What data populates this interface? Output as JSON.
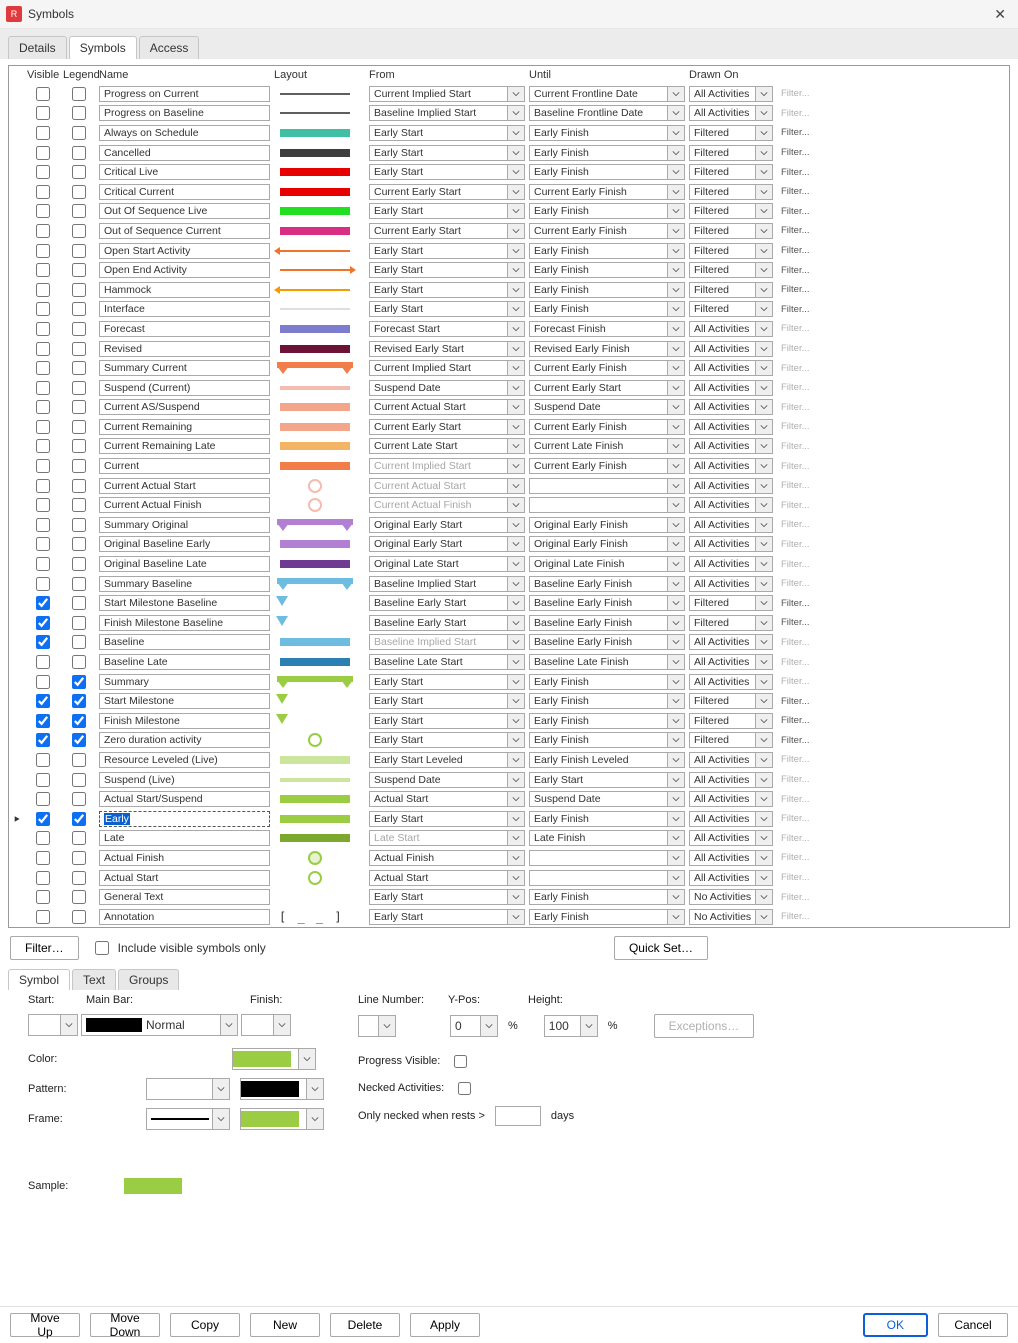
{
  "title": "Symbols",
  "main_tabs": [
    "Details",
    "Symbols",
    "Access"
  ],
  "active_main_tab": 1,
  "columns": [
    "Visible",
    "Legend",
    "Name",
    "Layout",
    "From",
    "Until",
    "Drawn On"
  ],
  "rows": [
    {
      "visible": false,
      "legend": false,
      "name": "Progress on Current",
      "style": {
        "kind": "line",
        "color": "#5f5f5f"
      },
      "from": "Current Implied Start",
      "from_disabled": false,
      "until": "Current Frontline Date",
      "until_disabled": false,
      "drawn": "All Activities",
      "filter_disabled": true
    },
    {
      "visible": false,
      "legend": false,
      "name": "Progress on Baseline",
      "style": {
        "kind": "line",
        "color": "#5f5f5f"
      },
      "from": "Baseline Implied Start",
      "from_disabled": false,
      "until": "Baseline Frontline Date",
      "until_disabled": false,
      "drawn": "All Activities",
      "filter_disabled": true
    },
    {
      "visible": false,
      "legend": false,
      "name": "Always on Schedule",
      "style": {
        "kind": "bar",
        "color": "#3fbfa3"
      },
      "from": "Early Start",
      "from_disabled": false,
      "until": "Early Finish",
      "until_disabled": false,
      "drawn": "Filtered",
      "filter_disabled": false
    },
    {
      "visible": false,
      "legend": false,
      "name": "Cancelled",
      "style": {
        "kind": "bar",
        "color": "#3e3e3e"
      },
      "from": "Early Start",
      "from_disabled": false,
      "until": "Early Finish",
      "until_disabled": false,
      "drawn": "Filtered",
      "filter_disabled": false
    },
    {
      "visible": false,
      "legend": false,
      "name": "Critical Live",
      "style": {
        "kind": "bar",
        "color": "#e80000"
      },
      "from": "Early Start",
      "from_disabled": false,
      "until": "Early Finish",
      "until_disabled": false,
      "drawn": "Filtered",
      "filter_disabled": false
    },
    {
      "visible": false,
      "legend": false,
      "name": "Critical Current",
      "style": {
        "kind": "bar",
        "color": "#e80000"
      },
      "from": "Current Early Start",
      "from_disabled": false,
      "until": "Current Early Finish",
      "until_disabled": false,
      "drawn": "Filtered",
      "filter_disabled": false
    },
    {
      "visible": false,
      "legend": false,
      "name": "Out Of Sequence Live",
      "style": {
        "kind": "bar",
        "color": "#21e021"
      },
      "from": "Early Start",
      "from_disabled": false,
      "until": "Early Finish",
      "until_disabled": false,
      "drawn": "Filtered",
      "filter_disabled": false
    },
    {
      "visible": false,
      "legend": false,
      "name": "Out of Sequence Current",
      "style": {
        "kind": "bar",
        "color": "#d82f84"
      },
      "from": "Current Early Start",
      "from_disabled": false,
      "until": "Current Early Finish",
      "until_disabled": false,
      "drawn": "Filtered",
      "filter_disabled": false
    },
    {
      "visible": false,
      "legend": false,
      "name": "Open Start Activity",
      "style": {
        "kind": "arrow-left",
        "color": "#f1742b"
      },
      "from": "Early Start",
      "from_disabled": false,
      "until": "Early Finish",
      "until_disabled": false,
      "drawn": "Filtered",
      "filter_disabled": false
    },
    {
      "visible": false,
      "legend": false,
      "name": "Open End Activity",
      "style": {
        "kind": "arrow-right",
        "color": "#f1742b"
      },
      "from": "Early Start",
      "from_disabled": false,
      "until": "Early Finish",
      "until_disabled": false,
      "drawn": "Filtered",
      "filter_disabled": false
    },
    {
      "visible": false,
      "legend": false,
      "name": "Hammock",
      "style": {
        "kind": "arrow-left",
        "color": "#f59b00"
      },
      "from": "Early Start",
      "from_disabled": false,
      "until": "Early Finish",
      "until_disabled": false,
      "drawn": "Filtered",
      "filter_disabled": false
    },
    {
      "visible": false,
      "legend": false,
      "name": "Interface",
      "style": {
        "kind": "line",
        "color": "#dedede"
      },
      "from": "Early Start",
      "from_disabled": false,
      "until": "Early Finish",
      "until_disabled": false,
      "drawn": "Filtered",
      "filter_disabled": false
    },
    {
      "visible": false,
      "legend": false,
      "name": "Forecast",
      "style": {
        "kind": "bar",
        "color": "#7d7ccf"
      },
      "from": "Forecast Start",
      "from_disabled": false,
      "until": "Forecast Finish",
      "until_disabled": false,
      "drawn": "All Activities",
      "filter_disabled": true
    },
    {
      "visible": false,
      "legend": false,
      "name": "Revised",
      "style": {
        "kind": "bar",
        "color": "#6c1237"
      },
      "from": "Revised Early Start",
      "from_disabled": false,
      "until": "Revised Early Finish",
      "until_disabled": false,
      "drawn": "All Activities",
      "filter_disabled": true
    },
    {
      "visible": false,
      "legend": false,
      "name": "Summary Current",
      "style": {
        "kind": "summary",
        "color": "#f17d49"
      },
      "from": "Current Implied Start",
      "from_disabled": false,
      "until": "Current Early Finish",
      "until_disabled": false,
      "drawn": "All Activities",
      "filter_disabled": true
    },
    {
      "visible": false,
      "legend": false,
      "name": "Suspend (Current)",
      "style": {
        "kind": "thin",
        "color": "#f4bcb0"
      },
      "from": "Suspend Date",
      "from_disabled": false,
      "until": "Current Early Start",
      "until_disabled": false,
      "drawn": "All Activities",
      "filter_disabled": true
    },
    {
      "visible": false,
      "legend": false,
      "name": "Current AS/Suspend",
      "style": {
        "kind": "bar",
        "color": "#f3a68a"
      },
      "from": "Current Actual Start",
      "from_disabled": false,
      "until": "Suspend Date",
      "until_disabled": false,
      "drawn": "All Activities",
      "filter_disabled": true
    },
    {
      "visible": false,
      "legend": false,
      "name": "Current Remaining",
      "style": {
        "kind": "bar",
        "color": "#f3a68a"
      },
      "from": "Current Early Start",
      "from_disabled": false,
      "until": "Current Early Finish",
      "until_disabled": false,
      "drawn": "All Activities",
      "filter_disabled": true
    },
    {
      "visible": false,
      "legend": false,
      "name": "Current Remaining Late",
      "style": {
        "kind": "bar",
        "color": "#f3b563"
      },
      "from": "Current Late Start",
      "from_disabled": false,
      "until": "Current Late Finish",
      "until_disabled": false,
      "drawn": "All Activities",
      "filter_disabled": true
    },
    {
      "visible": false,
      "legend": false,
      "name": "Current",
      "style": {
        "kind": "bar",
        "color": "#f17d49"
      },
      "from": "Current Implied Start",
      "from_disabled": true,
      "until": "Current Early Finish",
      "until_disabled": false,
      "drawn": "All Activities",
      "filter_disabled": true
    },
    {
      "visible": false,
      "legend": false,
      "name": "Current Actual Start",
      "style": {
        "kind": "circle",
        "color": "#f4bcb0"
      },
      "from": "Current Actual Start",
      "from_disabled": true,
      "until": "",
      "until_disabled": false,
      "drawn": "All Activities",
      "filter_disabled": true
    },
    {
      "visible": false,
      "legend": false,
      "name": "Current Actual Finish",
      "style": {
        "kind": "circle",
        "color": "#f4bcb0"
      },
      "from": "Current Actual Finish",
      "from_disabled": true,
      "until": "",
      "until_disabled": false,
      "drawn": "All Activities",
      "filter_disabled": true
    },
    {
      "visible": false,
      "legend": false,
      "name": "Summary Original",
      "style": {
        "kind": "summary",
        "color": "#b37fd3"
      },
      "from": "Original Early Start",
      "from_disabled": false,
      "until": "Original Early Finish",
      "until_disabled": false,
      "drawn": "All Activities",
      "filter_disabled": true
    },
    {
      "visible": false,
      "legend": false,
      "name": "Original Baseline Early",
      "style": {
        "kind": "bar",
        "color": "#b37fd3"
      },
      "from": "Original Early Start",
      "from_disabled": false,
      "until": "Original Early Finish",
      "until_disabled": false,
      "drawn": "All Activities",
      "filter_disabled": true
    },
    {
      "visible": false,
      "legend": false,
      "name": "Original Baseline Late",
      "style": {
        "kind": "bar",
        "color": "#6e3a92"
      },
      "from": "Original Late Start",
      "from_disabled": false,
      "until": "Original Late Finish",
      "until_disabled": false,
      "drawn": "All Activities",
      "filter_disabled": true
    },
    {
      "visible": false,
      "legend": false,
      "name": "Summary Baseline",
      "style": {
        "kind": "summary",
        "color": "#6ebde1"
      },
      "from": "Baseline Implied Start",
      "from_disabled": false,
      "until": "Baseline Early Finish",
      "until_disabled": false,
      "drawn": "All Activities",
      "filter_disabled": true
    },
    {
      "visible": true,
      "legend": false,
      "name": "Start Milestone Baseline",
      "style": {
        "kind": "tri",
        "color": "#6ebde1"
      },
      "from": "Baseline Early Start",
      "from_disabled": false,
      "until": "Baseline Early Finish",
      "until_disabled": false,
      "drawn": "Filtered",
      "filter_disabled": false
    },
    {
      "visible": true,
      "legend": false,
      "name": "Finish Milestone Baseline",
      "style": {
        "kind": "tri",
        "color": "#6ebde1"
      },
      "from": "Baseline Early Start",
      "from_disabled": false,
      "until": "Baseline Early Finish",
      "until_disabled": false,
      "drawn": "Filtered",
      "filter_disabled": false
    },
    {
      "visible": true,
      "legend": false,
      "name": "Baseline",
      "style": {
        "kind": "bar",
        "color": "#6ebde1"
      },
      "from": "Baseline Implied Start",
      "from_disabled": true,
      "until": "Baseline Early Finish",
      "until_disabled": false,
      "drawn": "All Activities",
      "filter_disabled": true
    },
    {
      "visible": false,
      "legend": false,
      "name": "Baseline Late",
      "style": {
        "kind": "bar",
        "color": "#2b7fb3"
      },
      "from": "Baseline Late Start",
      "from_disabled": false,
      "until": "Baseline Late Finish",
      "until_disabled": false,
      "drawn": "All Activities",
      "filter_disabled": true
    },
    {
      "visible": false,
      "legend": true,
      "name": "Summary",
      "style": {
        "kind": "summary",
        "color": "#9acd44"
      },
      "from": "Early Start",
      "from_disabled": false,
      "until": "Early Finish",
      "until_disabled": false,
      "drawn": "All Activities",
      "filter_disabled": true
    },
    {
      "visible": true,
      "legend": true,
      "name": "Start Milestone",
      "style": {
        "kind": "tri",
        "color": "#9acd44"
      },
      "from": "Early Start",
      "from_disabled": false,
      "until": "Early Finish",
      "until_disabled": false,
      "drawn": "Filtered",
      "filter_disabled": false
    },
    {
      "visible": true,
      "legend": true,
      "name": "Finish Milestone",
      "style": {
        "kind": "tri",
        "color": "#9acd44"
      },
      "from": "Early Start",
      "from_disabled": false,
      "until": "Early Finish",
      "until_disabled": false,
      "drawn": "Filtered",
      "filter_disabled": false
    },
    {
      "visible": true,
      "legend": true,
      "name": "Zero duration activity",
      "style": {
        "kind": "circle",
        "color": "#9acd44"
      },
      "from": "Early Start",
      "from_disabled": false,
      "until": "Early Finish",
      "until_disabled": false,
      "drawn": "Filtered",
      "filter_disabled": false
    },
    {
      "visible": false,
      "legend": false,
      "name": "Resource Leveled (Live)",
      "style": {
        "kind": "bar",
        "color": "#cbe59c"
      },
      "from": "Early Start Leveled",
      "from_disabled": false,
      "until": "Early Finish Leveled",
      "until_disabled": false,
      "drawn": "All Activities",
      "filter_disabled": true
    },
    {
      "visible": false,
      "legend": false,
      "name": "Suspend (Live)",
      "style": {
        "kind": "thin",
        "color": "#cbe59c"
      },
      "from": "Suspend Date",
      "from_disabled": false,
      "until": "Early Start",
      "until_disabled": false,
      "drawn": "All Activities",
      "filter_disabled": true
    },
    {
      "visible": false,
      "legend": false,
      "name": "Actual Start/Suspend",
      "style": {
        "kind": "bar",
        "color": "#9acd44"
      },
      "from": "Actual Start",
      "from_disabled": false,
      "until": "Suspend Date",
      "until_disabled": false,
      "drawn": "All Activities",
      "filter_disabled": true
    },
    {
      "visible": true,
      "legend": true,
      "name": "Early",
      "style": {
        "kind": "bar",
        "color": "#9acd44"
      },
      "from": "Early Start",
      "from_disabled": false,
      "until": "Early Finish",
      "until_disabled": false,
      "drawn": "All Activities",
      "filter_disabled": true,
      "selected": true,
      "indicator": true
    },
    {
      "visible": false,
      "legend": false,
      "name": "Late",
      "style": {
        "kind": "bar",
        "color": "#7ca82e"
      },
      "from": "Late Start",
      "from_disabled": true,
      "until": "Late Finish",
      "until_disabled": false,
      "drawn": "All Activities",
      "filter_disabled": true
    },
    {
      "visible": false,
      "legend": false,
      "name": "Actual Finish",
      "style": {
        "kind": "circle-fill",
        "color": "#9acd44"
      },
      "from": "Actual Finish",
      "from_disabled": false,
      "until": "",
      "until_disabled": false,
      "drawn": "All Activities",
      "filter_disabled": true
    },
    {
      "visible": false,
      "legend": false,
      "name": "Actual Start",
      "style": {
        "kind": "circle",
        "color": "#9acd44"
      },
      "from": "Actual Start",
      "from_disabled": false,
      "until": "",
      "until_disabled": false,
      "drawn": "All Activities",
      "filter_disabled": true
    },
    {
      "visible": false,
      "legend": false,
      "name": "General Text",
      "style": {
        "kind": "none",
        "color": "#ffffff"
      },
      "from": "Early Start",
      "from_disabled": false,
      "until": "Early Finish",
      "until_disabled": false,
      "drawn": "No Activities",
      "filter_disabled": true
    },
    {
      "visible": false,
      "legend": false,
      "name": "Annotation",
      "style": {
        "kind": "bracket",
        "color": "#555555"
      },
      "from": "Early Start",
      "from_disabled": false,
      "until": "Early Finish",
      "until_disabled": false,
      "drawn": "No Activities",
      "filter_disabled": true
    }
  ],
  "filter_text": "Filter...",
  "under_grid": {
    "filter_btn": "Filter…",
    "visible_only": "Include visible symbols only",
    "quickset": "Quick Set…"
  },
  "lower_tabs": [
    "Symbol",
    "Text",
    "Groups"
  ],
  "lower_active": 0,
  "symbol_panel": {
    "start_lbl": "Start:",
    "mainbar_lbl": "Main Bar:",
    "mainbar_val": "Normal",
    "finish_lbl": "Finish:",
    "color_lbl": "Color:",
    "color_val": "#9acd44",
    "pattern_lbl": "Pattern:",
    "pattern_fg": "#ffffff",
    "pattern_bg": "#000000",
    "frame_lbl": "Frame:",
    "frame_color": "#9acd44",
    "line_lbl": "Line Number:",
    "ypos_lbl": "Y-Pos:",
    "ypos_val": "0",
    "height_lbl": "Height:",
    "height_val": "100",
    "pct": "%",
    "exceptions": "Exceptions…",
    "progress_lbl": "Progress Visible:",
    "necked_lbl": "Necked Activities:",
    "only_necked": "Only necked when rests >",
    "days": "days",
    "sample_lbl": "Sample:"
  },
  "bottom": {
    "moveup": "Move Up",
    "movedown": "Move Down",
    "copy": "Copy",
    "new": "New",
    "delete": "Delete",
    "apply": "Apply",
    "ok": "OK",
    "cancel": "Cancel"
  }
}
